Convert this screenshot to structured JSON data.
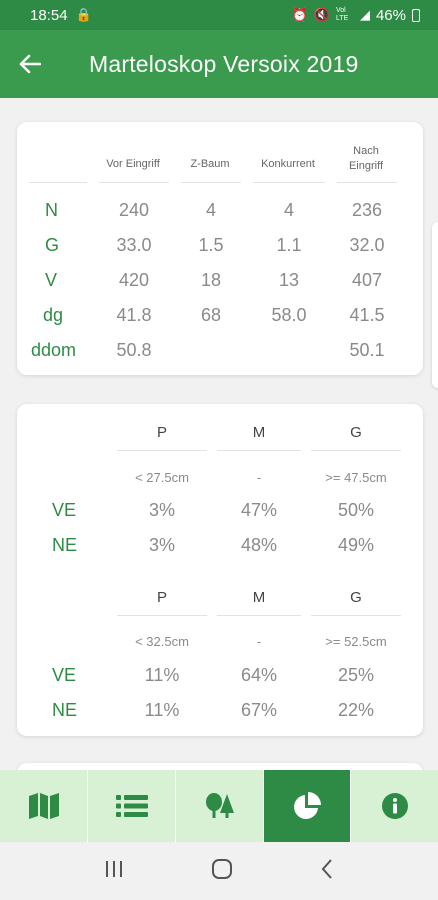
{
  "status": {
    "time": "18:54",
    "signal_text": "Vol LTE",
    "battery": "46%"
  },
  "app_bar": {
    "title": "Marteloskop Versoix 2019"
  },
  "table1": {
    "headers": [
      "Vor Eingriff",
      "Z-Baum",
      "Konkurrent",
      "Nach\nEingriff"
    ],
    "header_nach_1": "Nach",
    "header_nach_2": "Eingriff",
    "rows": [
      {
        "label": "N",
        "values": [
          "240",
          "4",
          "4",
          "236"
        ]
      },
      {
        "label": "G",
        "values": [
          "33.0",
          "1.5",
          "1.1",
          "32.0"
        ]
      },
      {
        "label": "V",
        "values": [
          "420",
          "18",
          "13",
          "407"
        ]
      },
      {
        "label": "dg",
        "values": [
          "41.8",
          "68",
          "58.0",
          "41.5"
        ]
      },
      {
        "label": "ddom",
        "values": [
          "50.8",
          "",
          "",
          "50.1"
        ]
      }
    ]
  },
  "table2": {
    "block1": {
      "cols": [
        "P",
        "M",
        "G"
      ],
      "ranges": [
        "< 27.5cm",
        "-",
        ">= 47.5cm"
      ],
      "rows": [
        {
          "label": "VE",
          "values": [
            "3%",
            "47%",
            "50%"
          ]
        },
        {
          "label": "NE",
          "values": [
            "3%",
            "48%",
            "49%"
          ]
        }
      ]
    },
    "block2": {
      "cols": [
        "P",
        "M",
        "G"
      ],
      "ranges": [
        "< 32.5cm",
        "-",
        ">= 52.5cm"
      ],
      "rows": [
        {
          "label": "VE",
          "values": [
            "11%",
            "64%",
            "25%"
          ]
        },
        {
          "label": "NE",
          "values": [
            "11%",
            "67%",
            "22%"
          ]
        }
      ]
    }
  },
  "bottom_nav": {
    "items": [
      "map-icon",
      "list-icon",
      "trees-icon",
      "pie-chart-icon",
      "info-icon"
    ],
    "active": "pie-chart-icon"
  },
  "colors": {
    "primary": "#3a9b4e",
    "dark": "#2e8b45",
    "nav_bg": "#d8f0d4"
  }
}
